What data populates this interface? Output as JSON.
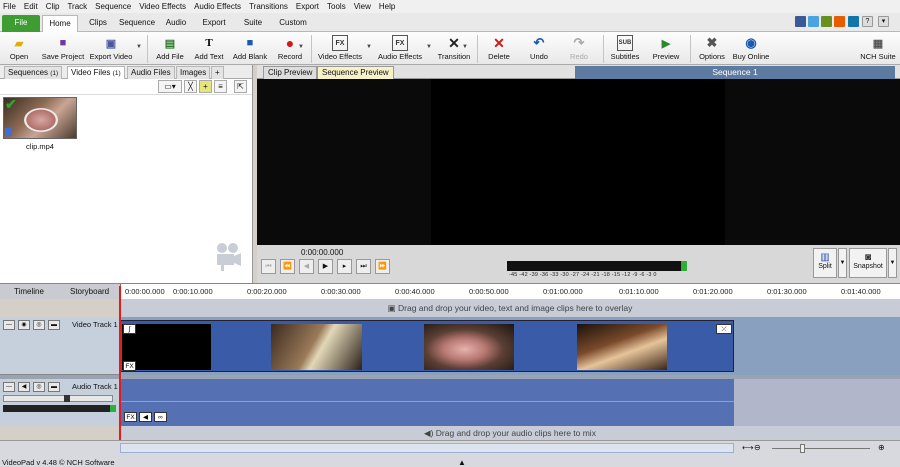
{
  "menu": [
    "File",
    "Edit",
    "Clip",
    "Track",
    "Sequence",
    "Video Effects",
    "Audio Effects",
    "Transitions",
    "Export",
    "Tools",
    "View",
    "Help"
  ],
  "tabs": [
    "File",
    "Home",
    "Clips",
    "Sequence",
    "Audio",
    "Export",
    "Suite",
    "Custom"
  ],
  "toolbar": [
    "Open",
    "Save Project",
    "Export Video",
    "Add File",
    "Add Text",
    "Add Blank",
    "Record",
    "Video Effects",
    "Audio Effects",
    "Transition",
    "Delete",
    "Undo",
    "Redo",
    "Subtitles",
    "Preview",
    "Options",
    "Buy Online",
    "NCH Suite"
  ],
  "bins": {
    "tabs": [
      "Sequences",
      "Video Files",
      "Audio Files",
      "Images",
      "+"
    ],
    "tab_counts": [
      "(1)",
      "(1)",
      "",
      ""
    ],
    "clip_name": "clip.mp4"
  },
  "preview": {
    "tabs": [
      "Clip Preview",
      "Sequence Preview"
    ],
    "title": "Sequence 1",
    "timecode": "0:00:00.000",
    "meter_scale": "-45 -42 -39 -36 -33 -30 -27 -24 -21 -18 -15 -12 -9 -6 -3 0",
    "split_label": "Split",
    "snapshot_label": "Snapshot"
  },
  "timeline": {
    "tabs": [
      "Timeline",
      "Storyboard"
    ],
    "ticks": [
      "0:00:00.000",
      "0:00:10.000",
      "0:00:20.000",
      "0:00:30.000",
      "0:00:40.000",
      "0:00:50.000",
      "0:01:00.000",
      "0:01:10.000",
      "0:01:20.000",
      "0:01:30.000",
      "0:01:40.000"
    ],
    "overlay_hint": "Drag and drop your video, text and image clips here to overlay",
    "video_track": "Video Track 1",
    "audio_track": "Audio Track 1",
    "audio_hint": "Drag and drop your audio clips here to mix",
    "fx_label": "FX"
  },
  "status": "VideoPad v 4.48 © NCH Software",
  "colors": {
    "file_tab": "#3d9d32",
    "accent_blue": "#5d7aa1",
    "playhead": "#e31b1b",
    "meter_green": "#2fae3a"
  }
}
